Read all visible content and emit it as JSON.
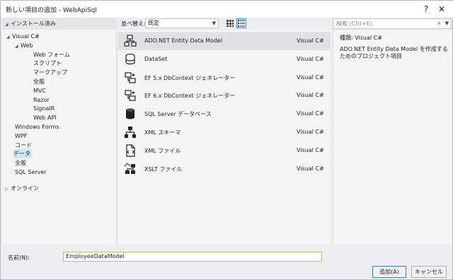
{
  "window": {
    "title": "新しい項目の追加 - WebApiSql"
  },
  "left": {
    "header": "インストール済み",
    "tree": [
      {
        "label": "Visual C#",
        "level": 0,
        "expander": "open"
      },
      {
        "label": "Web",
        "level": 1,
        "expander": "open"
      },
      {
        "label": "Web フォーム",
        "level": 2
      },
      {
        "label": "スクリプト",
        "level": 2
      },
      {
        "label": "マークアップ",
        "level": 2
      },
      {
        "label": "全般",
        "level": 2
      },
      {
        "label": "MVC",
        "level": 2
      },
      {
        "label": "Razor",
        "level": 2
      },
      {
        "label": "SignalR",
        "level": 2
      },
      {
        "label": "Web API",
        "level": 2
      },
      {
        "label": "Windows Forms",
        "level": 1
      },
      {
        "label": "WPF",
        "level": 1
      },
      {
        "label": "コード",
        "level": 1
      },
      {
        "label": "データ",
        "level": 1,
        "selected": true
      },
      {
        "label": "全般",
        "level": 1
      },
      {
        "label": "SQL Server",
        "level": 1
      }
    ],
    "online": "オンライン"
  },
  "toolbar": {
    "sort_label": "並べ替え:",
    "sort_value": "既定"
  },
  "search": {
    "placeholder": "検索 (Ctrl+E)"
  },
  "items": [
    {
      "name": "ADO.NET Entity Data Model",
      "lang": "Visual C#",
      "icon": "entity-model-icon"
    },
    {
      "name": "DataSet",
      "lang": "Visual C#",
      "icon": "dataset-icon"
    },
    {
      "name": "EF 5.x DbContext ジェネレーター",
      "lang": "Visual C#",
      "icon": "ef5-generator-icon"
    },
    {
      "name": "EF 6.x DbContext ジェネレーター",
      "lang": "Visual C#",
      "icon": "ef6-generator-icon"
    },
    {
      "name": "SQL Server データベース",
      "lang": "Visual C#",
      "icon": "database-icon"
    },
    {
      "name": "XML スキーマ",
      "lang": "Visual C#",
      "icon": "xml-schema-icon"
    },
    {
      "name": "XML ファイル",
      "lang": "Visual C#",
      "icon": "xml-file-icon"
    },
    {
      "name": "XSLT ファイル",
      "lang": "Visual C#",
      "icon": "xslt-file-icon"
    }
  ],
  "detail": {
    "kind": "種類:  Visual C#",
    "description": "ADO.NET Entity Data Model を作成するためのプロジェクト項目"
  },
  "name_field": {
    "label": "名前(N):",
    "value": "EmployeeDataModel"
  },
  "buttons": {
    "add": "追加(A)",
    "cancel": "キャンセル"
  },
  "colors": {
    "selection": "#cce8ff",
    "accent": "#3c7fd4"
  }
}
